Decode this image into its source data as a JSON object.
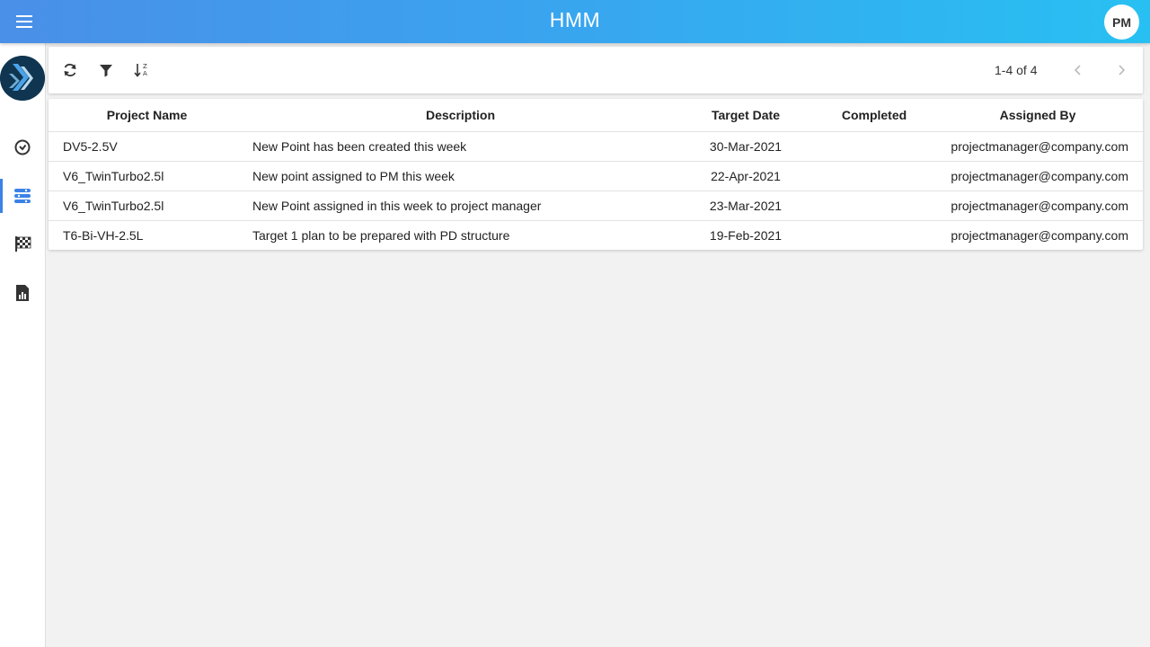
{
  "header": {
    "title": "HMM",
    "avatar_initials": "PM",
    "gradient_start": "#4a8fe8",
    "gradient_end": "#28c0f2"
  },
  "sidebar": {
    "logo": "company-logo",
    "items": [
      {
        "icon": "clock-icon",
        "active": false
      },
      {
        "icon": "list-icon",
        "active": true
      },
      {
        "icon": "checkered-flag-icon",
        "active": false
      },
      {
        "icon": "report-chart-icon",
        "active": false
      }
    ],
    "accent_color": "#3b82e6"
  },
  "toolbar": {
    "tools": [
      "refresh-icon",
      "filter-icon",
      "sort-icon"
    ],
    "pagination": "1-4 of 4"
  },
  "table": {
    "columns": [
      "Project Name",
      "Description",
      "Target Date",
      "Completed",
      "Assigned By"
    ],
    "rows": [
      {
        "project": "DV5-2.5V",
        "description": "New Point has been created this week",
        "target_date": "30-Mar-2021",
        "completed": "",
        "assigned_by": "projectmanager@company.com"
      },
      {
        "project": "V6_TwinTurbo2.5l",
        "description": "New point assigned to PM this week",
        "target_date": "22-Apr-2021",
        "completed": "",
        "assigned_by": "projectmanager@company.com"
      },
      {
        "project": "V6_TwinTurbo2.5l",
        "description": "New Point assigned in this week to project manager",
        "target_date": "23-Mar-2021",
        "completed": "",
        "assigned_by": "projectmanager@company.com"
      },
      {
        "project": "T6-Bi-VH-2.5L",
        "description": "Target 1 plan to be prepared with PD structure",
        "target_date": "19-Feb-2021",
        "completed": "",
        "assigned_by": "projectmanager@company.com"
      }
    ]
  }
}
